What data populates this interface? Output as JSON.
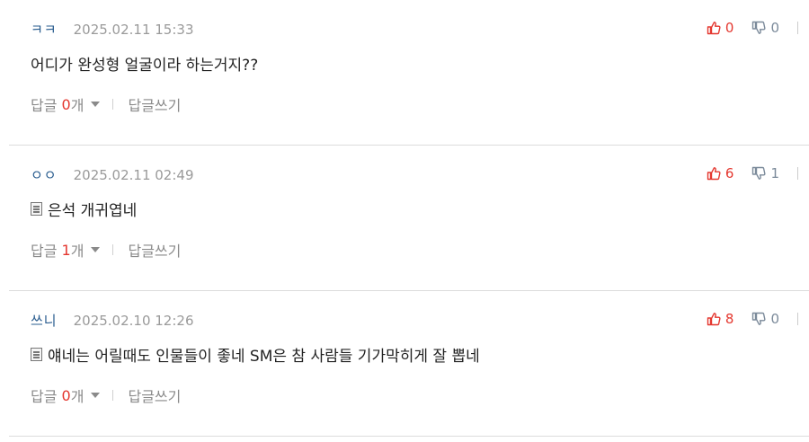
{
  "labels": {
    "reply": "답글",
    "unit": "개",
    "write_reply": "답글쓰기"
  },
  "colors": {
    "accent": "#e4372f",
    "nickname": "#2a5d8f",
    "muted": "#9a9a9a"
  },
  "comments": [
    {
      "nickname": "ㅋㅋ",
      "date": "2025.02.11 15:33",
      "text": "어디가 완성형 얼굴이라 하는거지??",
      "memo_icon": false,
      "likes": "0",
      "dislikes": "0",
      "reply_count": "0"
    },
    {
      "nickname": "ㅇㅇ",
      "date": "2025.02.11 02:49",
      "text": "은석 개귀엽네",
      "memo_icon": true,
      "likes": "6",
      "dislikes": "1",
      "reply_count": "1"
    },
    {
      "nickname": "쓰니",
      "date": "2025.02.10 12:26",
      "text": "얘네는 어릴때도 인물들이 좋네 SM은 참 사람들 기가막히게 잘 뽑네",
      "memo_icon": true,
      "likes": "8",
      "dislikes": "0",
      "reply_count": "0"
    }
  ]
}
